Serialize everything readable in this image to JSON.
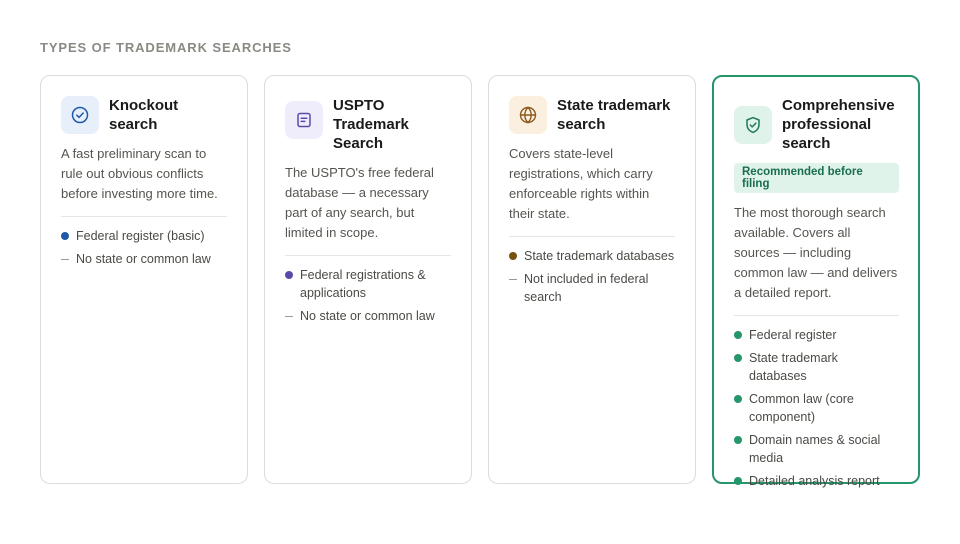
{
  "section_title": "TYPES OF TRADEMARK SEARCHES",
  "cards": [
    {
      "title": "Knockout search",
      "icon": "check-circle-icon",
      "icon_color": "#1e5aa8",
      "icon_bg": "#e6effa",
      "description": "A fast preliminary scan to rule out obvious conflicts before investing more time.",
      "items": [
        {
          "text": "Federal register (basic)",
          "marker": "dot",
          "color": "#1e5aa8"
        },
        {
          "text": "No state or common law",
          "marker": "dash"
        }
      ]
    },
    {
      "title": "USPTO Trademark Search",
      "icon": "document-icon",
      "icon_color": "#5a4aa8",
      "icon_bg": "#efedfb",
      "description": "The USPTO's free federal database — a necessary part of any search, but limited in scope.",
      "items": [
        {
          "text": "Federal registrations & applications",
          "marker": "dot",
          "color": "#5a4aa8"
        },
        {
          "text": "No state or common law",
          "marker": "dash"
        }
      ]
    },
    {
      "title": "State trademark search",
      "icon": "globe-icon",
      "icon_color": "#8a5a1e",
      "icon_bg": "#fbefdf",
      "description": "Covers state-level registrations, which carry enforceable rights within their state.",
      "items": [
        {
          "text": "State trademark databases",
          "marker": "dot",
          "color": "#7a4f12"
        },
        {
          "text": "Not included in federal search",
          "marker": "dash"
        }
      ]
    },
    {
      "title": "Comprehensive professional search",
      "icon": "shield-check-icon",
      "icon_color": "#1f7a55",
      "icon_bg": "#e0f3ea",
      "badge": "Recommended before filing",
      "description": "The most thorough search available. Covers all sources — including common law — and delivers a detailed report.",
      "items": [
        {
          "text": "Federal register",
          "marker": "dot",
          "color": "#25956a"
        },
        {
          "text": "State trademark databases",
          "marker": "dot",
          "color": "#25956a"
        },
        {
          "text": "Common law (core component)",
          "marker": "dot",
          "color": "#25956a"
        },
        {
          "text": "Domain names & social media",
          "marker": "dot",
          "color": "#25956a"
        },
        {
          "text": "Detailed analysis report",
          "marker": "dot",
          "color": "#25956a"
        }
      ]
    }
  ]
}
